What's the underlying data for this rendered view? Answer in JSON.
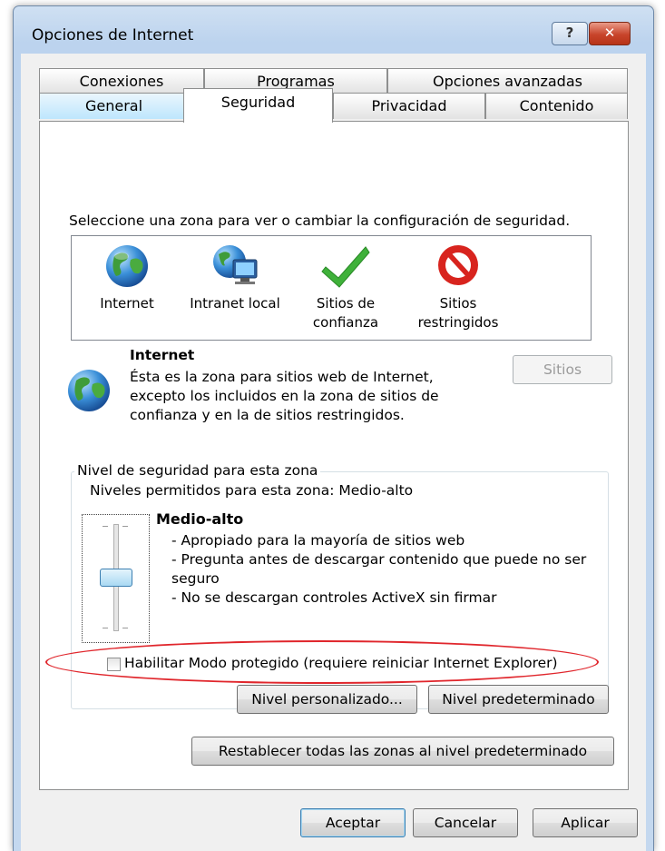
{
  "window": {
    "title": "Opciones de Internet",
    "help_label": "?",
    "close_label": "✕"
  },
  "tabs": {
    "back_row": [
      "Conexiones",
      "Programas",
      "Opciones avanzadas"
    ],
    "front_row": [
      "General",
      "Seguridad",
      "Privacidad",
      "Contenido"
    ],
    "selected": "Seguridad"
  },
  "zones": {
    "instruction": "Seleccione una zona para ver o cambiar la configuración de seguridad.",
    "items": [
      {
        "label_line1": "Internet",
        "label_line2": "",
        "icon": "globe-icon"
      },
      {
        "label_line1": "Intranet local",
        "label_line2": "",
        "icon": "intranet-icon"
      },
      {
        "label_line1": "Sitios de",
        "label_line2": "confianza",
        "icon": "checkmark-icon"
      },
      {
        "label_line1": "Sitios",
        "label_line2": "restringidos",
        "icon": "no-entry-icon"
      }
    ]
  },
  "zone_info": {
    "name": "Internet",
    "desc_line1": "Ésta es la zona para sitios web de Internet,",
    "desc_line2": "excepto los incluidos en la zona de sitios de",
    "desc_line3": "confianza y en la de sitios restringidos.",
    "sites_button": "Sitios"
  },
  "security_level": {
    "group_title": "Nivel de seguridad para esta zona",
    "allowed_levels": "Niveles permitidos para esta zona: Medio-alto",
    "level_name": "Medio-alto",
    "bullet1": "- Apropiado para la mayoría de sitios web",
    "bullet2_line1": "- Pregunta antes de descargar contenido que puede no ser",
    "bullet2_line2": "seguro",
    "bullet3": "- No se descargan controles ActiveX sin firmar",
    "slider_level": "Medio-alto",
    "protected_mode_label": "Habilitar Modo protegido (requiere reiniciar Internet Explorer)",
    "protected_mode_checked": false,
    "custom_level_button": "Nivel personalizado...",
    "default_level_button": "Nivel predeterminado"
  },
  "reset_all_button": "Restablecer todas las zonas al nivel predeterminado",
  "footer": {
    "ok": "Aceptar",
    "cancel": "Cancelar",
    "apply": "Aplicar"
  },
  "colors": {
    "highlight_ellipse": "#e0262c",
    "close_button": "#c8442b"
  }
}
